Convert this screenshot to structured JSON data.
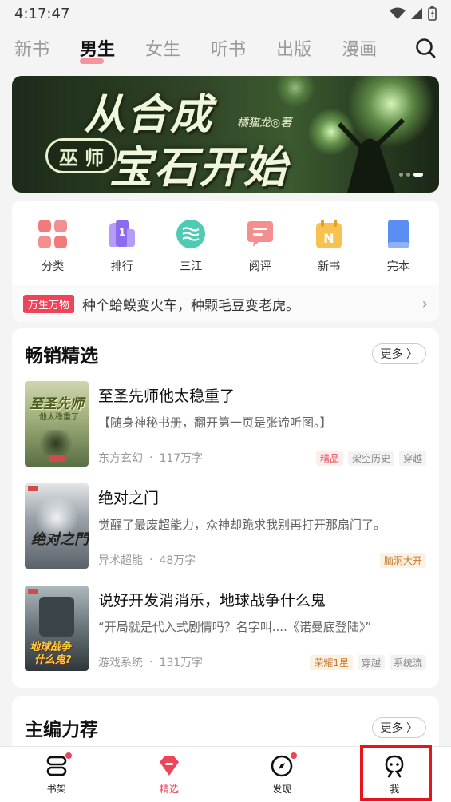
{
  "status_bar": {
    "time": "4:17:47"
  },
  "top_tabs": [
    {
      "label": "新书",
      "active": false
    },
    {
      "label": "男生",
      "active": true
    },
    {
      "label": "女生",
      "active": false
    },
    {
      "label": "听书",
      "active": false
    },
    {
      "label": "出版",
      "active": false
    },
    {
      "label": "漫画",
      "active": false
    }
  ],
  "banner": {
    "title_line1": "从合成",
    "title_line2": "宝石开始",
    "badge": "巫 师",
    "author": "橘猫龙◎著"
  },
  "categories": [
    {
      "label": "分类",
      "icon": "category-grid-icon",
      "color": "#f06a6a"
    },
    {
      "label": "排行",
      "icon": "ranking-icon",
      "color": "#8c6bf0"
    },
    {
      "label": "三江",
      "icon": "sanjiang-icon",
      "color": "#3cc0a8"
    },
    {
      "label": "阅评",
      "icon": "review-icon",
      "color": "#f06a6a"
    },
    {
      "label": "新书",
      "icon": "new-book-icon",
      "color": "#f3b63a"
    },
    {
      "label": "完本",
      "icon": "finished-book-icon",
      "color": "#5b8ef2"
    }
  ],
  "promo": {
    "badge": "万生万物",
    "text": "种个蛤蟆变火车，种颗毛豆变老虎。"
  },
  "bestsellers": {
    "title": "畅销精选",
    "more": "更多 〉",
    "books": [
      {
        "title": "至圣先师他太稳重了",
        "desc": "【随身神秘书册，翻开第一页是张谛听图。】",
        "genre": "东方玄幻",
        "words": "117万字",
        "tags": [
          {
            "text": "精品",
            "style": "red"
          },
          {
            "text": "架空历史",
            "style": "gray"
          },
          {
            "text": "穿越",
            "style": "gray"
          }
        ]
      },
      {
        "title": "绝对之门",
        "desc": "觉醒了最废超能力，众神却跪求我别再打开那扇门了。",
        "genre": "异术超能",
        "words": "48万字",
        "tags": [
          {
            "text": "脑洞大开",
            "style": "orange"
          }
        ]
      },
      {
        "title": "说好开发消消乐，地球战争什么鬼",
        "desc": "“开局就是代入式剧情吗？名字叫....《诺曼底登陆》”",
        "genre": "游戏系统",
        "words": "131万字",
        "tags": [
          {
            "text": "荣耀1星",
            "style": "orange"
          },
          {
            "text": "穿越",
            "style": "gray"
          },
          {
            "text": "系统流",
            "style": "gray"
          }
        ]
      }
    ]
  },
  "editor_picks": {
    "title": "主编力荐",
    "more": "更多 〉"
  },
  "bottom_nav": [
    {
      "label": "书架",
      "icon": "bookshelf-icon",
      "active": false,
      "dot": true
    },
    {
      "label": "精选",
      "icon": "featured-gem-icon",
      "active": true,
      "dot": false
    },
    {
      "label": "发现",
      "icon": "compass-icon",
      "active": false,
      "dot": true
    },
    {
      "label": "我",
      "icon": "profile-icon",
      "active": false,
      "dot": false
    }
  ],
  "colors": {
    "accent": "#ee4359",
    "highlight": "#e8141a"
  }
}
